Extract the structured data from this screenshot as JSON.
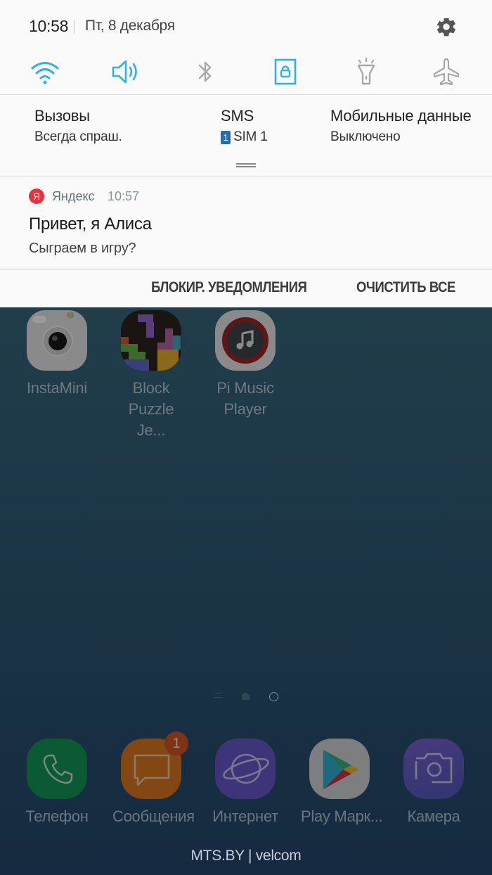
{
  "status": {
    "time": "10:58",
    "date": "Пт, 8 декабря"
  },
  "quick_settings": [
    {
      "name": "wifi",
      "icon": "wifi-icon",
      "active": true
    },
    {
      "name": "sound",
      "icon": "speaker-icon",
      "active": true
    },
    {
      "name": "bluetooth",
      "icon": "bluetooth-icon",
      "active": false
    },
    {
      "name": "rotation-lock",
      "icon": "screen-lock-icon",
      "active": true
    },
    {
      "name": "flashlight",
      "icon": "flashlight-icon",
      "active": false
    },
    {
      "name": "airplane",
      "icon": "airplane-icon",
      "active": false
    }
  ],
  "sim": {
    "calls": {
      "title": "Вызовы",
      "value": "Всегда спраш."
    },
    "sms": {
      "title": "SMS",
      "sim_number": "1",
      "value": "SIM 1"
    },
    "data": {
      "title": "Мобильные данные",
      "value": "Выключено"
    }
  },
  "notification": {
    "app": "Яндекс",
    "app_icon_letter": "Я",
    "time": "10:57",
    "title": "Привет, я Алиса",
    "text": "Сыграем в игру?"
  },
  "actions": {
    "block": "БЛОКИР. УВЕДОМЛЕНИЯ",
    "clear": "ОЧИСТИТЬ ВСЕ"
  },
  "home_apps": [
    {
      "label": "InstaMini"
    },
    {
      "label": "Block Puzzle Je..."
    },
    {
      "label": "Pi Music Player"
    }
  ],
  "dock": [
    {
      "label": "Телефон"
    },
    {
      "label": "Сообщения",
      "badge": "1"
    },
    {
      "label": "Интернет"
    },
    {
      "label": "Play Марк..."
    },
    {
      "label": "Камера"
    }
  ],
  "carrier": "MTS.BY | velcom",
  "colors": {
    "accent": "#2fb3e3",
    "inactive": "#a8a8a8",
    "yandex": "#e8323c"
  }
}
